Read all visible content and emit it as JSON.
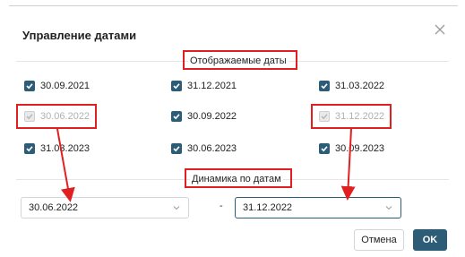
{
  "dialog": {
    "title": "Управление датами",
    "close_icon": "close-icon"
  },
  "displayed_dates": {
    "label": "Отображаемые даты",
    "items": [
      {
        "label": "30.09.2021",
        "checked": true,
        "disabled": false
      },
      {
        "label": "31.12.2021",
        "checked": true,
        "disabled": false
      },
      {
        "label": "31.03.2022",
        "checked": true,
        "disabled": false
      },
      {
        "label": "30.06.2022",
        "checked": true,
        "disabled": true
      },
      {
        "label": "30.09.2022",
        "checked": true,
        "disabled": false
      },
      {
        "label": "31.12.2022",
        "checked": true,
        "disabled": true
      },
      {
        "label": "31.03.2023",
        "checked": true,
        "disabled": false
      },
      {
        "label": "30.06.2023",
        "checked": true,
        "disabled": false
      },
      {
        "label": "30.09.2023",
        "checked": true,
        "disabled": false
      }
    ]
  },
  "dynamics": {
    "label": "Динамика по датам",
    "from_value": "30.06.2022",
    "separator": "-",
    "to_value": "31.12.2022"
  },
  "buttons": {
    "cancel": "Отмена",
    "ok": "OK"
  },
  "colors": {
    "accent": "#2d5c76",
    "annotation": "#e02020"
  }
}
